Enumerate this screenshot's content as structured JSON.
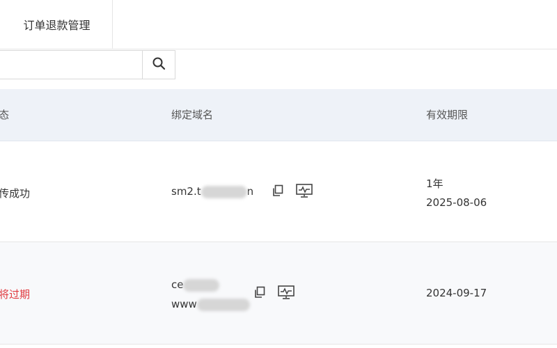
{
  "tabs": {
    "refund_label": "订单退款管理"
  },
  "search": {
    "value": "",
    "placeholder": "",
    "icon": "search-icon"
  },
  "table": {
    "headers": {
      "status": "态",
      "domain": "绑定域名",
      "validity": "有效期限"
    },
    "rows": [
      {
        "status": "传成功",
        "domain_lines": [
          "sm2.t",
          "n"
        ],
        "validity_duration": "1年",
        "validity_date": "2025-08-06"
      },
      {
        "status": "将过期",
        "domain_lines": [
          "ce",
          "www"
        ],
        "validity_duration": "",
        "validity_date": "2024-09-17"
      }
    ]
  },
  "colors": {
    "header_bg": "#eef2f8",
    "expiring_status": "#e0393e",
    "row_alt_bg": "#f8f9fb"
  },
  "icons": [
    "search-icon",
    "copy-icon",
    "monitor-icon"
  ]
}
